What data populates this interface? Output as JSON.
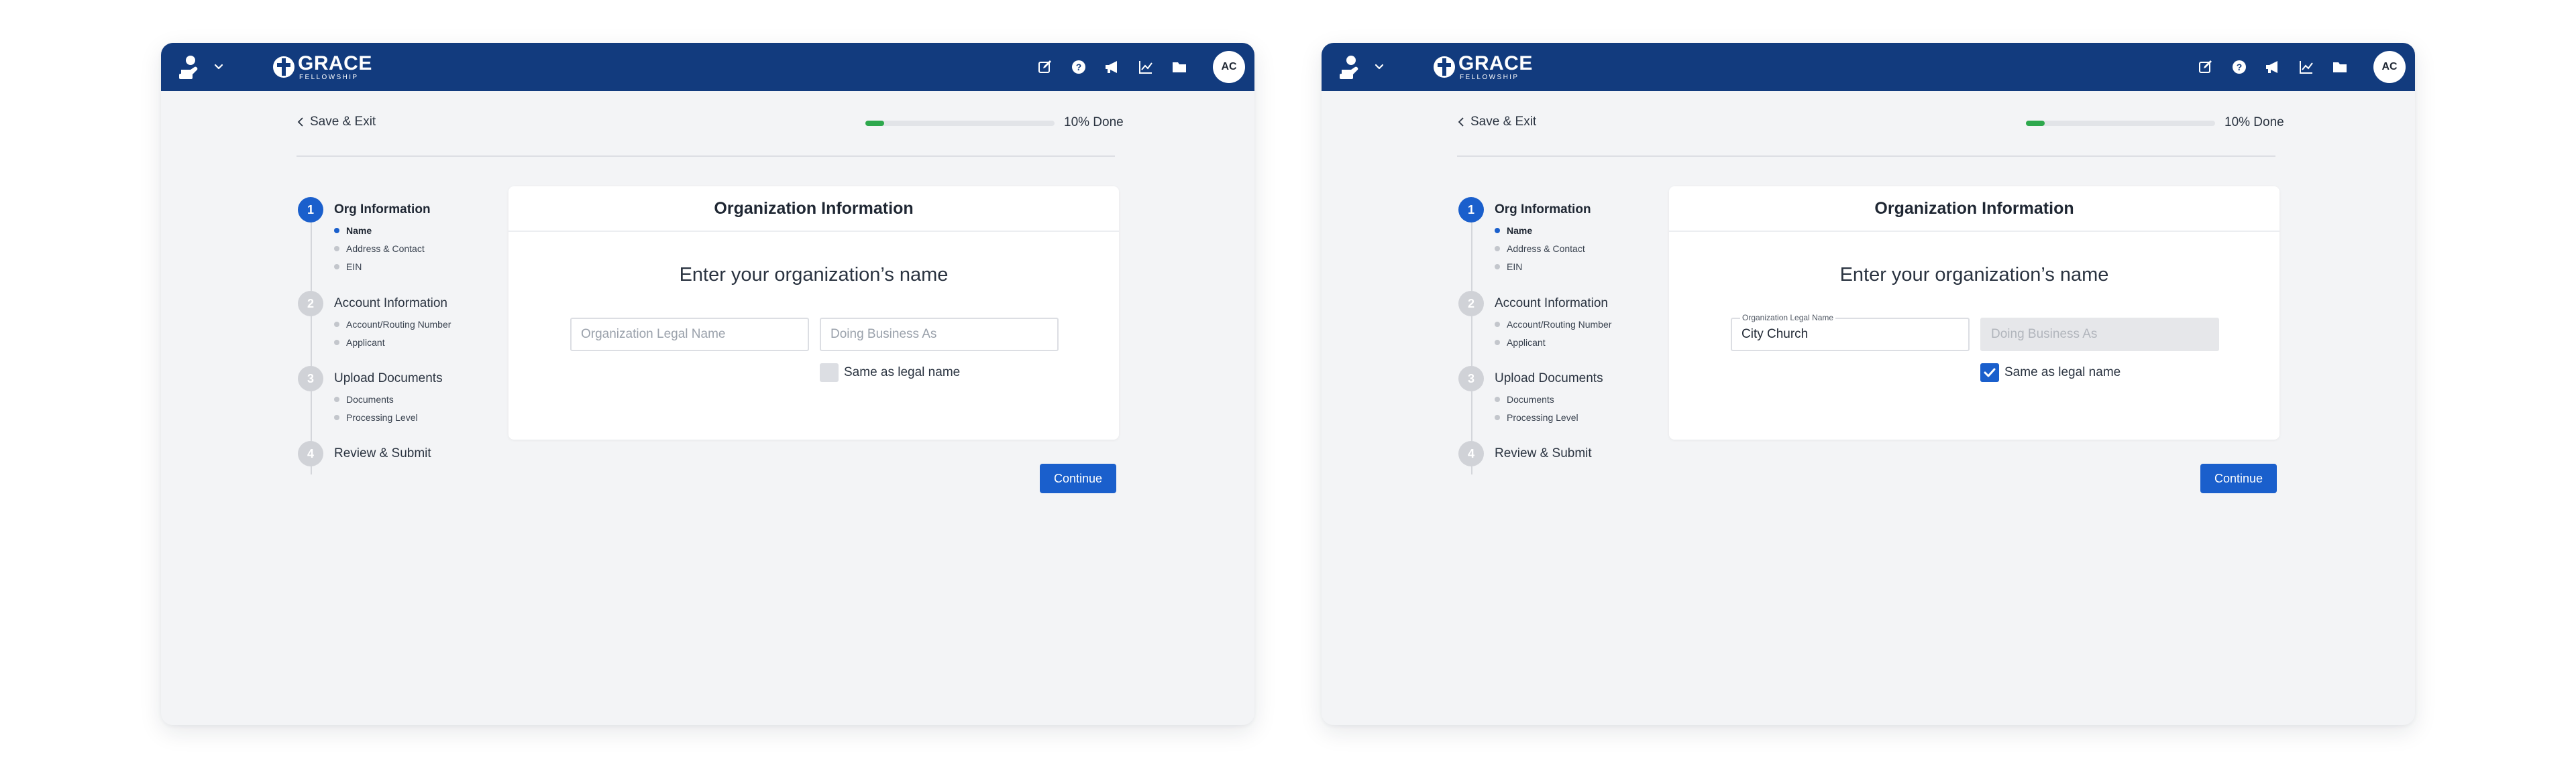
{
  "header": {
    "logo_name": "GRACE",
    "logo_subtitle": "FELLOWSHIP",
    "avatar_initials": "AC",
    "icons": [
      "hand-person-icon",
      "chevron-down-icon",
      "edit-icon",
      "help-icon",
      "megaphone-icon",
      "chart-icon",
      "folder-icon"
    ]
  },
  "nav": {
    "back_label": "Save & Exit"
  },
  "progress": {
    "value": 0.1,
    "label": "10% Done"
  },
  "steps": [
    {
      "number": "1",
      "title": "Org Information",
      "subs": [
        "Name",
        "Address & Contact",
        "EIN"
      ]
    },
    {
      "number": "2",
      "title": "Account Information",
      "subs": [
        "Account/Routing Number",
        "Applicant"
      ]
    },
    {
      "number": "3",
      "title": "Upload Documents",
      "subs": [
        "Documents",
        "Processing Level"
      ]
    },
    {
      "number": "4",
      "title": "Review & Submit",
      "subs": []
    }
  ],
  "form": {
    "card_title": "Organization Information",
    "prompt": "Enter your organization’s name",
    "legal_name_placeholder": "Organization Legal Name",
    "dba_placeholder": "Doing Business As",
    "same_as_label": "Same as legal name",
    "continue_label": "Continue"
  },
  "panels": [
    {
      "state": "empty",
      "legal_name_value": "",
      "same_as_checked": false
    },
    {
      "state": "filled",
      "legal_name_label": "Organization Legal Name",
      "legal_name_value": "City Church",
      "same_as_checked": true,
      "dba_disabled": true
    }
  ],
  "colors": {
    "header": "#123b7e",
    "accent": "#1a5fcc",
    "progress": "#2ea84d",
    "panel_bg": "#f3f4f6"
  }
}
